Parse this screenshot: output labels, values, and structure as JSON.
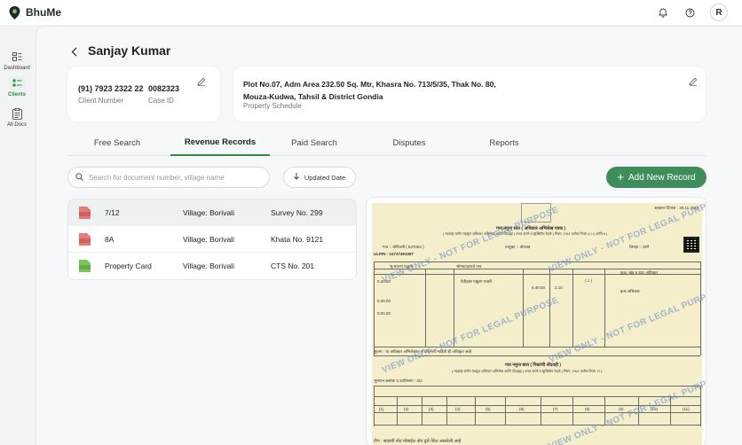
{
  "app": {
    "name": "BhuMe",
    "avatar_initial": "R"
  },
  "sidebar": {
    "items": [
      {
        "label": "Dashboard",
        "icon": "dashboard-icon"
      },
      {
        "label": "Clients",
        "icon": "clients-icon"
      },
      {
        "label": "All Docs",
        "icon": "docs-icon"
      }
    ]
  },
  "page": {
    "title": "Sanjay Kumar"
  },
  "client_card": {
    "phone": "(91) 7923 2322 22",
    "phone_label": "Client Number",
    "case_id": "0082323",
    "case_id_label": "Case ID"
  },
  "property_card": {
    "line1": "Plot No.07, Adm Area 232.50 Sq. Mtr, Khasra No. 713/5/35, Thak No. 80,",
    "line2": "Mouza-Kudwa, Tahsil & District Gondia",
    "label": "Property Schedule"
  },
  "tabs": [
    "Free Search",
    "Revenue Records",
    "Paid Search",
    "Disputes",
    "Reports"
  ],
  "toolbar": {
    "search_placeholder": "Search for document number, village name",
    "sort_label": "Updated Date",
    "add_label": "Add New Record"
  },
  "records": [
    {
      "name": "7/12",
      "badge": "7/12",
      "village": "Village: Borivali",
      "number": "Survey No. 299",
      "color": "#e47a7a"
    },
    {
      "name": "8A",
      "badge": "8A",
      "village": "Village: Borivali",
      "number": "Khata No. 9121",
      "color": "#e47a7a"
    },
    {
      "name": "Property Card",
      "badge": "PC",
      "village": "Village: Borivali",
      "number": "CTS No. 201",
      "color": "#7cc45c"
    }
  ],
  "document": {
    "date": "अहवाल दिनांक : 30.11.2023",
    "title1": "गाव नमुना सात ( अधिकार अभिलेख पत्रक )",
    "subtitle1": "( महाराष्ट्र जमीन महसूल अधिकार अभिलेख आणि नोंदवह्या ( तयार करणे व सुस्थितीत ठेवणे ) नियम, १९७१ यातील नियम ३,५,६ आणि ७ )",
    "village_line": "गाव :- बोरीवली ( 537063 )",
    "taluka_line": "तालुका :- बोरवाड",
    "district_line": "जिल्हा :- ठाणे",
    "ulpin": "ULPIN : 24737491087",
    "title2": "गाव नमुना बारा ( पिकांची नोंदवही )",
    "subtitle2": "( महाराष्ट्र जमीन महसूल अधिकार अभिलेख आणि नोंदवह्या ( तयार करणे व सुस्थितीत ठेवणे ) नियम, १९७१ यातील नियम २९ )",
    "survey_line": "भूमापन क्रमांक व उपविभाग : 4/2",
    "note": "टीप : सदरची नोंद मोबाईल ॲप द्वारे पेरेल असलेली आहे",
    "watermark": "VIEW ONLY - NOT FOR LEGAL PURPOSE"
  },
  "colors": {
    "accent": "#3e8e5b",
    "doc_bg": "#f4efca"
  }
}
